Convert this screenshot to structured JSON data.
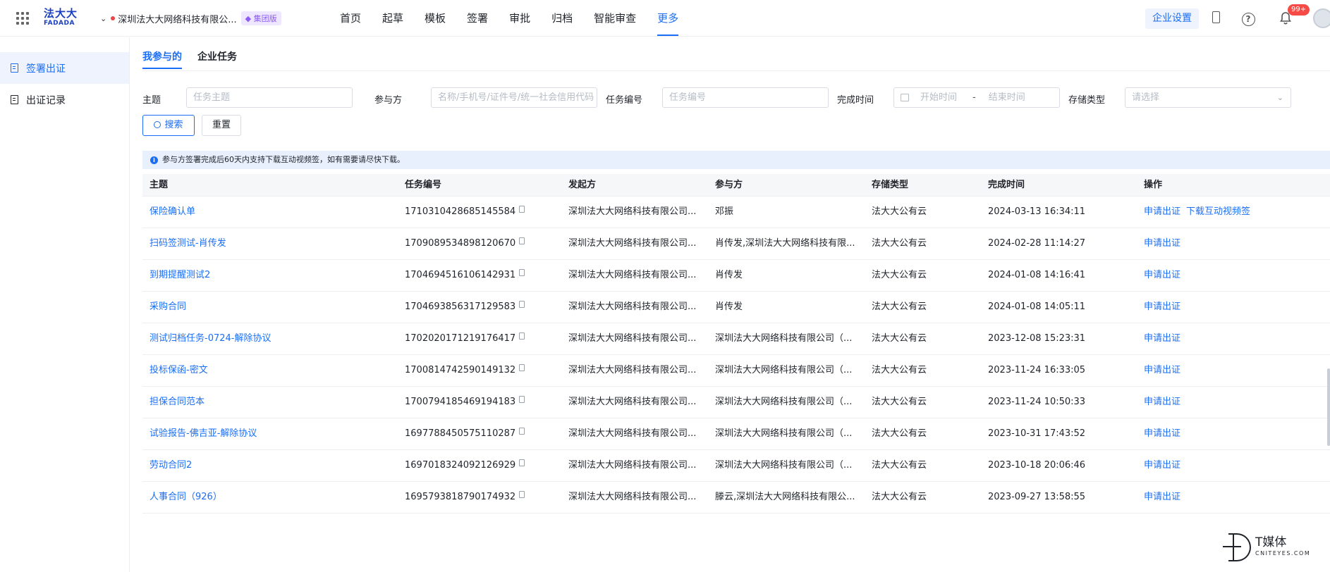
{
  "header": {
    "logo_cn": "法大大",
    "logo_en": "FADADA",
    "company": "深圳法大大网络科技有限公...",
    "edition_badge": "集团版",
    "nav": [
      "首页",
      "起草",
      "模板",
      "签署",
      "审批",
      "归档",
      "智能审查",
      "更多"
    ],
    "active_nav": "更多",
    "enterprise_settings": "企业设置",
    "notifications": "99+"
  },
  "sidebar": {
    "items": [
      {
        "label": "签署出证",
        "active": true
      },
      {
        "label": "出证记录",
        "active": false
      }
    ]
  },
  "tabs": [
    "我参与的",
    "企业任务"
  ],
  "filters": {
    "subject_label": "主题",
    "subject_placeholder": "任务主题",
    "participant_label": "参与方",
    "participant_placeholder": "名称/手机号/证件号/统一社会信用代码",
    "task_no_label": "任务编号",
    "task_no_placeholder": "任务编号",
    "finish_time_label": "完成时间",
    "start_placeholder": "开始时间",
    "range_sep": "-",
    "end_placeholder": "结束时间",
    "storage_label": "存储类型",
    "storage_placeholder": "请选择",
    "search_button": "搜索",
    "reset_button": "重置"
  },
  "notice": "参与方签署完成后60天内支持下载互动视频签，如有需要请尽快下载。",
  "table": {
    "columns": [
      "主题",
      "任务编号",
      "发起方",
      "参与方",
      "存储类型",
      "完成时间",
      "操作"
    ],
    "rows": [
      {
        "subject": "保险确认单",
        "task_no": "1710310428685145584",
        "initiator": "深圳法大大网络科技有限公司...",
        "participant": "邓振",
        "storage": "法大大公有云",
        "time": "2024-03-13 16:34:11",
        "ops": [
          "申请出证",
          "下载互动视频签"
        ]
      },
      {
        "subject": "扫码签测试-肖传发",
        "task_no": "1709089534898120670",
        "initiator": "深圳法大大网络科技有限公司...",
        "participant": "肖传发,深圳法大大网络科技有限...",
        "storage": "法大大公有云",
        "time": "2024-02-28 11:14:27",
        "ops": [
          "申请出证"
        ]
      },
      {
        "subject": "到期提醒测试2",
        "task_no": "1704694516106142931",
        "initiator": "深圳法大大网络科技有限公司...",
        "participant": "肖传发",
        "storage": "法大大公有云",
        "time": "2024-01-08 14:16:41",
        "ops": [
          "申请出证"
        ]
      },
      {
        "subject": "采购合同",
        "task_no": "1704693856317129583",
        "initiator": "深圳法大大网络科技有限公司...",
        "participant": "肖传发",
        "storage": "法大大公有云",
        "time": "2024-01-08 14:05:11",
        "ops": [
          "申请出证"
        ]
      },
      {
        "subject": "测试归档任务-0724-解除协议",
        "task_no": "1702020171219176417",
        "initiator": "深圳法大大网络科技有限公司...",
        "participant": "深圳法大大网络科技有限公司（...",
        "storage": "法大大公有云",
        "time": "2023-12-08 15:23:31",
        "ops": [
          "申请出证"
        ]
      },
      {
        "subject": "投标保函-密文",
        "task_no": "1700814742590149132",
        "initiator": "深圳法大大网络科技有限公司...",
        "participant": "深圳法大大网络科技有限公司（...",
        "storage": "法大大公有云",
        "time": "2023-11-24 16:33:05",
        "ops": [
          "申请出证"
        ]
      },
      {
        "subject": "担保合同范本",
        "task_no": "1700794185469194183",
        "initiator": "深圳法大大网络科技有限公司...",
        "participant": "深圳法大大网络科技有限公司（...",
        "storage": "法大大公有云",
        "time": "2023-11-24 10:50:33",
        "ops": [
          "申请出证"
        ]
      },
      {
        "subject": "试验报告-佛吉亚-解除协议",
        "task_no": "1697788450575110287",
        "initiator": "深圳法大大网络科技有限公司...",
        "participant": "深圳法大大网络科技有限公司（...",
        "storage": "法大大公有云",
        "time": "2023-10-31 17:43:52",
        "ops": [
          "申请出证"
        ]
      },
      {
        "subject": "劳动合同2",
        "task_no": "1697018324092126929",
        "initiator": "深圳法大大网络科技有限公司...",
        "participant": "深圳法大大网络科技有限公司（...",
        "storage": "法大大公有云",
        "time": "2023-10-18 20:06:46",
        "ops": [
          "申请出证"
        ]
      },
      {
        "subject": "人事合同（926）",
        "task_no": "1695793818790174932",
        "initiator": "深圳法大大网络科技有限公司...",
        "participant": "滕云,深圳法大大网络科技有限公...",
        "storage": "法大大公有云",
        "time": "2023-09-27 13:58:55",
        "ops": [
          "申请出证"
        ]
      }
    ]
  },
  "watermark": {
    "cn": "T媒体",
    "en": "CNITEYES.COM"
  }
}
